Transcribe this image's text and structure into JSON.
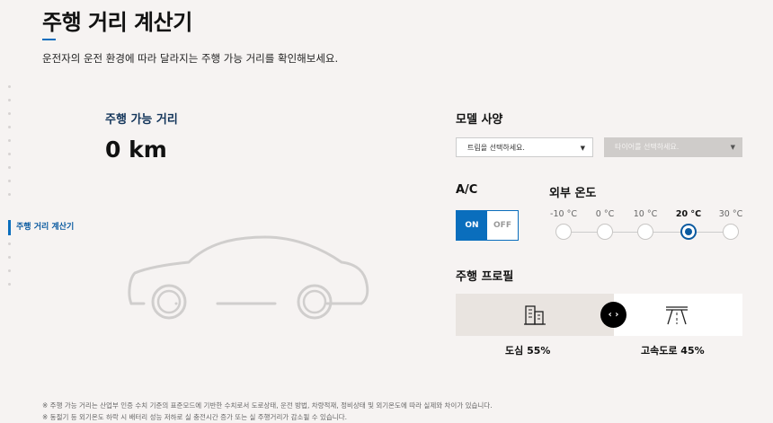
{
  "header": {
    "title": "주행 거리 계산기",
    "subtitle": "운전자의 운전 환경에 따라 달라지는 주행 가능 거리를 확인해보세요."
  },
  "side_nav": {
    "active_label": "주행 거리 계산기"
  },
  "range": {
    "label": "주행 가능 거리",
    "value": "0 km"
  },
  "model": {
    "label": "모델 사양",
    "trim_placeholder": "트림을 선택하세요.",
    "tire_placeholder": "타이어를 선택하세요."
  },
  "ac": {
    "label": "A/C",
    "on_label": "ON",
    "off_label": "OFF",
    "state": "ON"
  },
  "temperature": {
    "label": "외부 온도",
    "options": [
      "-10 °C",
      "0 °C",
      "10 °C",
      "20 °C",
      "30 °C"
    ],
    "selected": "20 °C"
  },
  "profile": {
    "label": "주행 프로필",
    "city_label": "도심 55%",
    "highway_label": "고속도로 45%",
    "city_percent": 55,
    "highway_percent": 45,
    "handle_glyph": "‹ ›"
  },
  "footnotes": [
    "※ 주행 가능 거리는 산업부 인증 수치 기준의 표준모드에 기반한 수치로서 도로상태, 운전 방법, 차량적재, 정비상태 및 외기온도에 따라 실제와 차이가 있습니다.",
    "※ 동절기 등 외기온도 하락 시 배터리 성능 저하로 실 충전시간 증가 또는 실 주행거리가 감소될 수 있습니다."
  ],
  "colors": {
    "accent": "#0a6ebd",
    "city_bg": "#e9e4e0",
    "page_bg": "#f6f3f2"
  }
}
